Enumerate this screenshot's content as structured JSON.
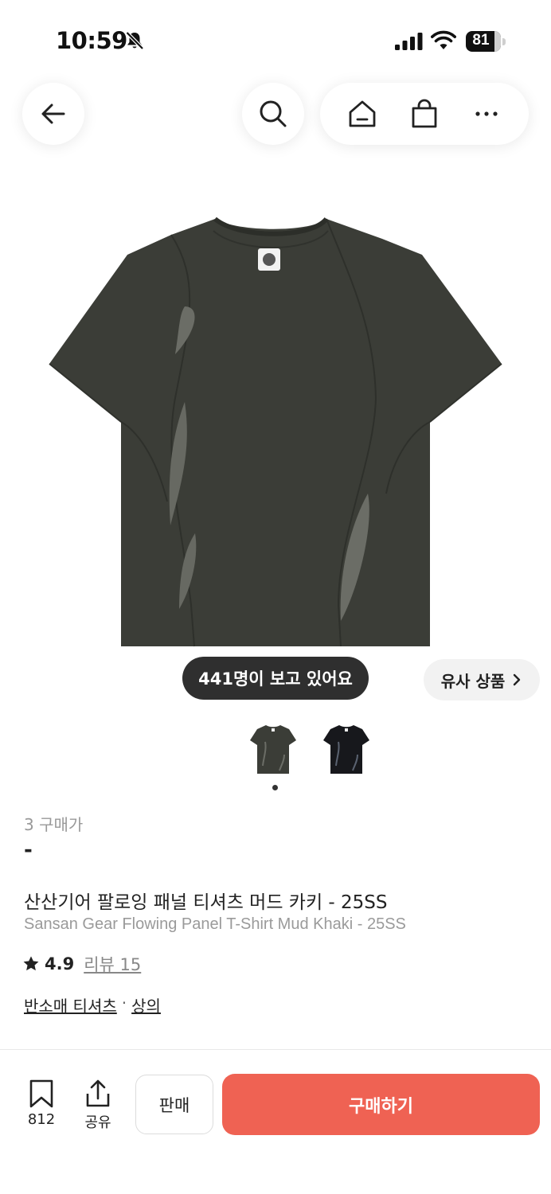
{
  "status_bar": {
    "time": "10:59",
    "battery": "81",
    "icons": [
      "bell-slash-icon",
      "cellular-signal-icon",
      "wifi-icon",
      "battery-icon"
    ]
  },
  "nav": {
    "icons": [
      "arrow-left-icon",
      "search-icon",
      "home-icon",
      "shopping-bag-icon",
      "more-dots-icon"
    ]
  },
  "product": {
    "viewers_text": "441명이 보고 있어요",
    "similar_label": "유사 상품",
    "purchase_count": "3 구매가",
    "price": "-",
    "title_ko": "산산기어 팔로잉 패널 티셔츠 머드 카키 - 25SS",
    "title_en": "Sansan Gear Flowing Panel T-Shirt Mud Khaki - 25SS",
    "rating": "4.9",
    "review_label": "리뷰 15",
    "category_1": "반소매 티셔츠",
    "category_separator": "·",
    "category_2": "상의",
    "thumbnails": [
      "mud-khaki",
      "black"
    ],
    "colors": {
      "shirt_khaki": "#3b3d37",
      "shirt_black": "#17181c"
    }
  },
  "bottom_bar": {
    "bookmark_count": "812",
    "share_label": "공유",
    "sell_label": "판매",
    "buy_label": "구매하기",
    "buy_color": "#ef6253"
  }
}
